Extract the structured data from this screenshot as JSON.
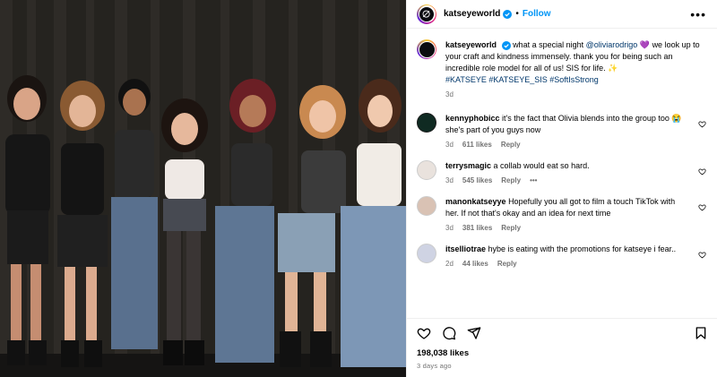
{
  "header": {
    "username": "katseyeworld",
    "dot": "•",
    "follow_label": "Follow",
    "more_label": "•••"
  },
  "caption": {
    "username": "katseyeworld",
    "text_1": "what a special night",
    "mention": "@oliviarodrigo",
    "emoji_heart": "💜",
    "text_2": "we look up to your craft and kindness immensely. thank you for being such an incredible role model for all of us! SIS for life.",
    "emoji_sparkle": "✨",
    "hashtags": "#KATSEYE #KATSEYE_SIS #SoftIsStrong",
    "time": "3d"
  },
  "comments": [
    {
      "username": "kennyphobicc",
      "text": "it's the fact that Olivia blends into the group too",
      "emoji": "😭",
      "text_tail": "she's part of you guys now",
      "time": "3d",
      "likes": "611 likes",
      "reply": "Reply"
    },
    {
      "username": "terrysmagic",
      "text": "a collab would eat so hard.",
      "time": "3d",
      "likes": "545 likes",
      "reply": "Reply",
      "more": "•••"
    },
    {
      "username": "manonkatseyye",
      "text": "Hopefully you all got to film a touch TikTok with her. If not that's okay and an idea for next time",
      "time": "3d",
      "likes": "381 likes",
      "reply": "Reply"
    },
    {
      "username": "itselliotrae",
      "text": "hybe is eating with the promotions for katseye i fear..",
      "time": "2d",
      "likes": "44 likes",
      "reply": "Reply"
    }
  ],
  "footer": {
    "likes": "198,038 likes",
    "ago": "3 days ago"
  },
  "icons": {
    "verified": "verified-badge-icon",
    "like": "heart-icon",
    "comment": "comment-bubble-icon",
    "share": "paper-plane-icon",
    "save": "bookmark-icon"
  },
  "colors": {
    "accent": "#0095f6",
    "verified": "#0095f6",
    "secondary_text": "#737373",
    "link": "#00376b",
    "divider": "#efefef"
  }
}
